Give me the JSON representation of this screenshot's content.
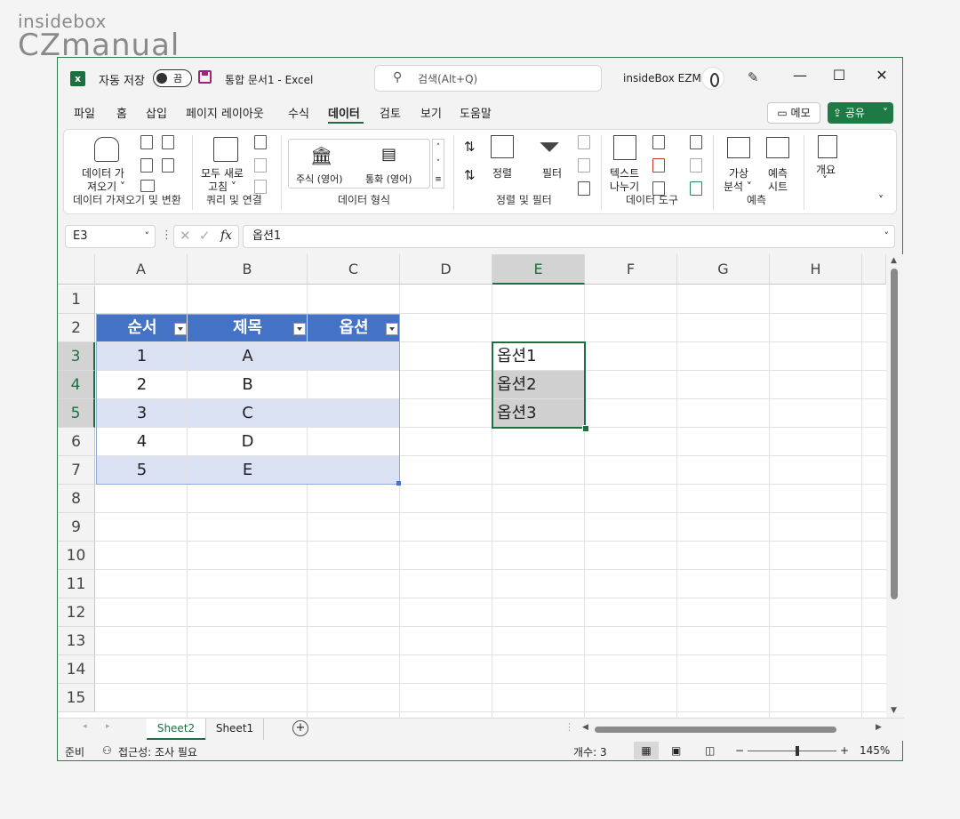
{
  "watermark": {
    "line1": "insidebox",
    "line2": "CZmanual"
  },
  "titlebar": {
    "excel_icon": "excel-logo",
    "autosave_label": "자동 저장",
    "autosave_state": "끔",
    "doc_title": "통합 문서1  -  Excel",
    "search_placeholder": "검색(Alt+Q)",
    "user_name": "insideBox EZM",
    "minimize": "—",
    "maximize": "☐",
    "close": "✕"
  },
  "menu": {
    "items": [
      "파일",
      "홈",
      "삽입",
      "페이지 레이아웃",
      "수식",
      "데이터",
      "검토",
      "보기",
      "도움말"
    ],
    "active": "데이터",
    "memo_label": "메모",
    "share_label": "공유"
  },
  "ribbon": {
    "get_data_label_1": "데이터 가",
    "get_data_label_2": "져오기 ˅",
    "refresh_label_1": "모두 새로",
    "refresh_label_2": "고침 ˅",
    "stocks_label": "주식 (영어)",
    "currency_label": "통화 (영어)",
    "sort_label": "정렬",
    "filter_label": "필터",
    "text_to_col_1": "텍스트",
    "text_to_col_2": "나누기",
    "whatif_1": "가상",
    "whatif_2": "분석 ˅",
    "forecast_1": "예측",
    "forecast_2": "시트",
    "outline_1": "개요",
    "outline_2": "˅",
    "groups": [
      "데이터 가져오기 및 변환",
      "쿼리 및 연결",
      "데이터 형식",
      "정렬 및 필터",
      "데이터 도구",
      "예측"
    ]
  },
  "formula": {
    "name_box": "E3",
    "fx_label": "fx",
    "content": "옵션1"
  },
  "grid": {
    "columns": [
      "A",
      "B",
      "C",
      "D",
      "E",
      "F",
      "G",
      "H"
    ],
    "rows": [
      "1",
      "2",
      "3",
      "4",
      "5",
      "6",
      "7",
      "8",
      "9",
      "10",
      "11",
      "12",
      "13",
      "14",
      "15"
    ],
    "table": {
      "headers": [
        "순서",
        "제목",
        "옵션"
      ],
      "rows": [
        [
          "1",
          "A",
          ""
        ],
        [
          "2",
          "B",
          ""
        ],
        [
          "3",
          "C",
          ""
        ],
        [
          "4",
          "D",
          ""
        ],
        [
          "5",
          "E",
          ""
        ]
      ]
    },
    "selection_values": [
      "옵션1",
      "옵션2",
      "옵션3"
    ]
  },
  "sheets": {
    "tabs": [
      "Sheet2",
      "Sheet1"
    ],
    "active": "Sheet2"
  },
  "status": {
    "mode": "준비",
    "accessibility": "접근성: 조사 필요",
    "count": "개수: 3",
    "zoom": "145%"
  },
  "colors": {
    "accent": "#1d6f42",
    "table_header": "#4472c4",
    "table_band": "#d9e1f2",
    "selection_fill": "#d0d0d0"
  }
}
